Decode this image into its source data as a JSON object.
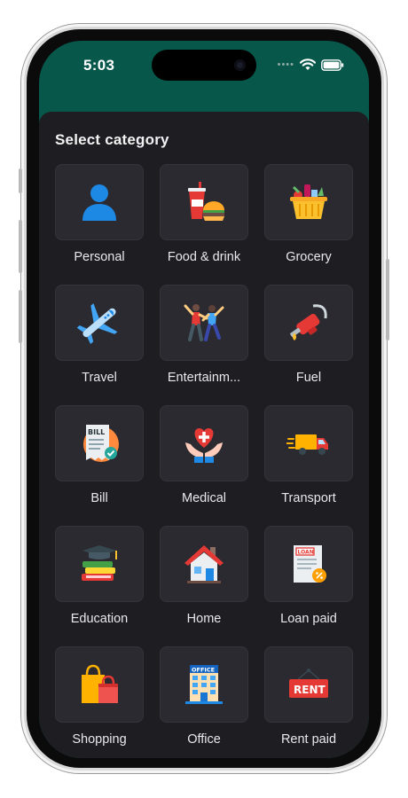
{
  "status_bar": {
    "time": "5:03"
  },
  "sheet": {
    "title": "Select category"
  },
  "categories": [
    {
      "label": "Personal",
      "icon": "person-icon"
    },
    {
      "label": "Food & drink",
      "icon": "food-drink-icon"
    },
    {
      "label": "Grocery",
      "icon": "grocery-basket-icon"
    },
    {
      "label": "Travel",
      "icon": "airplane-icon"
    },
    {
      "label": "Entertainm...",
      "icon": "dancing-icon"
    },
    {
      "label": "Fuel",
      "icon": "fuel-nozzle-icon"
    },
    {
      "label": "Bill",
      "icon": "bill-icon"
    },
    {
      "label": "Medical",
      "icon": "medical-heart-icon"
    },
    {
      "label": "Transport",
      "icon": "truck-icon"
    },
    {
      "label": "Education",
      "icon": "books-graduation-icon"
    },
    {
      "label": "Home",
      "icon": "house-icon"
    },
    {
      "label": "Loan paid",
      "icon": "loan-document-icon"
    },
    {
      "label": "Shopping",
      "icon": "shopping-bags-icon"
    },
    {
      "label": "Office",
      "icon": "office-building-icon"
    },
    {
      "label": "Rent paid",
      "icon": "rent-sign-icon"
    }
  ],
  "icon_text": {
    "bill": "BILL",
    "loan": "LOAN",
    "office": "OFFICE",
    "rent": "RENT"
  },
  "colors": {
    "header_green": "#07584b",
    "sheet_background": "#1d1d22",
    "tile_background": "#2a2a30"
  }
}
